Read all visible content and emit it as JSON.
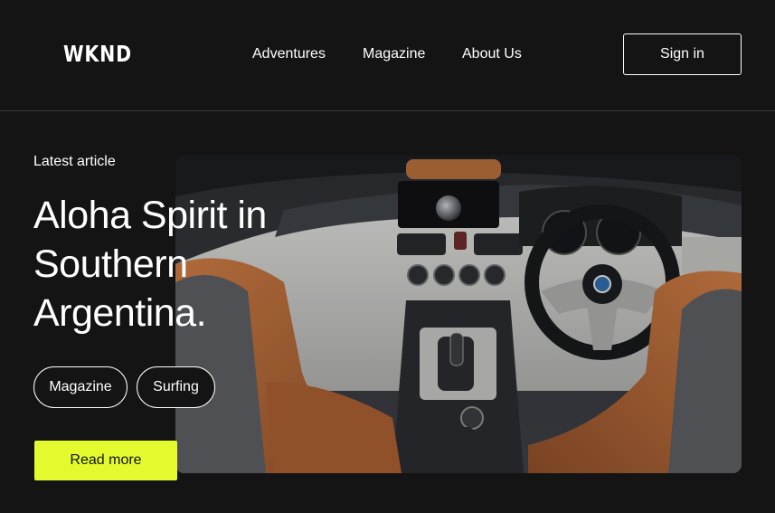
{
  "header": {
    "logo": "WKND",
    "nav": [
      "Adventures",
      "Magazine",
      "About Us"
    ],
    "sign_in_label": "Sign in"
  },
  "hero": {
    "eyebrow": "Latest article",
    "title_lines": [
      "Aloha Spirit in",
      "Southern",
      "Argentina."
    ],
    "tags": [
      "Magazine",
      "Surfing"
    ],
    "cta_label": "Read more"
  },
  "colors": {
    "background": "#141414",
    "accent": "#e2fa2e",
    "text": "#ffffff",
    "leather": "#b5683a"
  },
  "icons": {
    "steering_wheel": "bmw-steering-wheel",
    "gear_shift": "gear-shift"
  }
}
